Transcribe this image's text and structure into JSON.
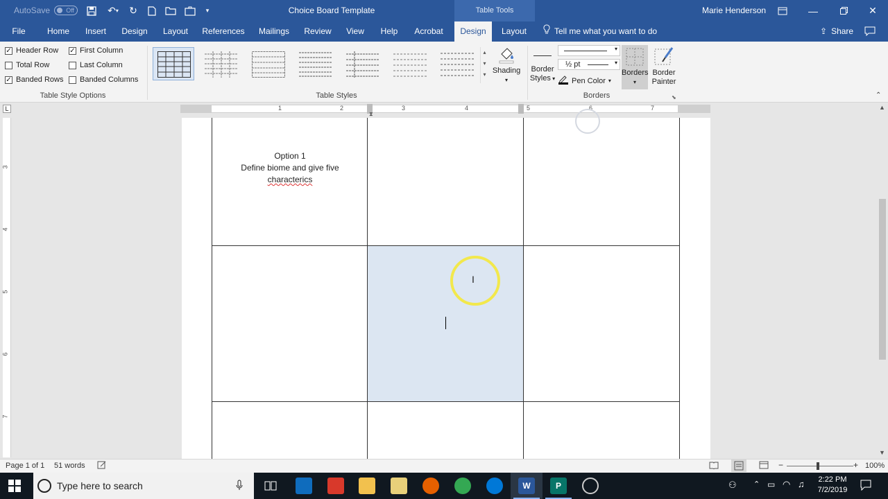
{
  "titlebar": {
    "autosave_label": "AutoSave",
    "autosave_state": "Off",
    "doc_title": "Choice Board Template",
    "context_tab": "Table Tools",
    "user_name": "Marie Henderson"
  },
  "tabs": [
    {
      "label": "File"
    },
    {
      "label": "Home"
    },
    {
      "label": "Insert"
    },
    {
      "label": "Design"
    },
    {
      "label": "Layout"
    },
    {
      "label": "References"
    },
    {
      "label": "Mailings"
    },
    {
      "label": "Review"
    },
    {
      "label": "View"
    },
    {
      "label": "Help"
    },
    {
      "label": "Acrobat"
    },
    {
      "label": "Design"
    },
    {
      "label": "Layout"
    }
  ],
  "tellme": "Tell me what you want to do",
  "share": "Share",
  "ribbon": {
    "options": {
      "header_row": "Header Row",
      "first_column": "First Column",
      "total_row": "Total Row",
      "last_column": "Last Column",
      "banded_rows": "Banded Rows",
      "banded_columns": "Banded Columns",
      "group_label": "Table Style Options"
    },
    "table_styles_label": "Table Styles",
    "shading_label": "Shading",
    "border_styles_line1": "Border",
    "border_styles_line2": "Styles",
    "pen_weight": "½ pt",
    "pen_color": "Pen Color",
    "borders_label": "Borders",
    "border_painter_line1": "Border",
    "border_painter_line2": "Painter",
    "borders_group_label": "Borders"
  },
  "ruler_numbers": [
    "1",
    "2",
    "3",
    "4",
    "5",
    "6",
    "7"
  ],
  "vruler_numbers": [
    "3",
    "4",
    "5",
    "6",
    "7"
  ],
  "document": {
    "cell_line1": "Option 1",
    "cell_line2": "Define biome and give five",
    "cell_line3": "characterics"
  },
  "status": {
    "page": "Page 1 of 1",
    "words": "51 words",
    "zoom": "100%"
  },
  "taskbar": {
    "search_placeholder": "Type here to search",
    "time": "2:22 PM",
    "date": "7/2/2019"
  },
  "colors": {
    "word_blue": "#2b579a",
    "cell_highlight": "#dce6f2"
  }
}
